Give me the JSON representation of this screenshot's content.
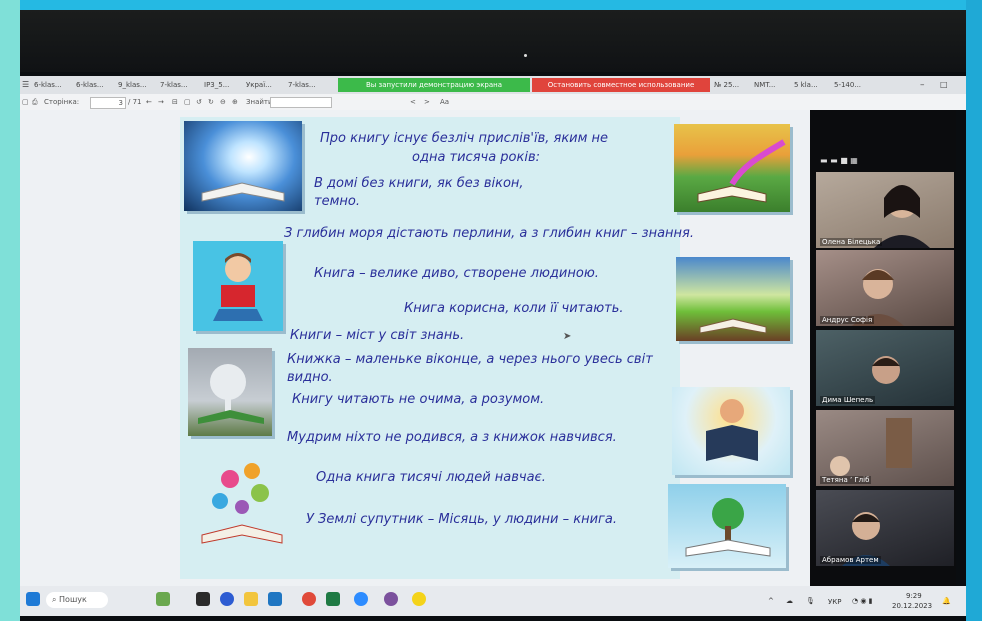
{
  "browser": {
    "tabs": [
      "6-klas...",
      "6-klas...",
      "9_klas...",
      "7-klas...",
      "IP3_5...",
      "Украї...",
      "7-klas...",
      "№ 25...",
      "NMT...",
      "5 kla...",
      "5-140..."
    ],
    "share_banner": "Вы запустили демонстрацию экрана",
    "stop_share": "Остановить совместное использование",
    "address_text": "Аа",
    "nav_back": "<",
    "nav_forward": ">"
  },
  "viewer_toolbar": {
    "page_label": "Сторінка:",
    "page_value": "3",
    "page_total": "/ 71",
    "find_label": "Знайти:"
  },
  "slide": {
    "lines": [
      "Про книгу існує безліч прислів'їв, яким не",
      "одна тисяча років:",
      "В домі без книги, як без вікон,",
      "темно.",
      "З глибин моря дістають перлини, а з глибин книг – знання.",
      "Книга – велике диво, створене людиною.",
      "Книга корисна, коли її читають.",
      "Книги – міст у світ знань.",
      "Книжка – маленьке віконце, а через нього увесь світ",
      "видно.",
      "Книгу читають не очима, а розумом.",
      "Мудрим ніхто не родився, а з книжок навчився.",
      "Одна книга тисячі людей навчає.",
      "У Землі супутник – Місяць, у людини – книга."
    ]
  },
  "participants": [
    {
      "name": "Олена Білецька",
      "color": "#8a7a6c"
    },
    {
      "name": "Андрус Софія",
      "color": "#6d5a52"
    },
    {
      "name": "Дима Шепель",
      "color": "#3a4c52"
    },
    {
      "name": "Тетяна ’ Гліб",
      "color": "#7a6a64"
    },
    {
      "name": "Абрамов Артем",
      "color": "#3b3d44"
    }
  ],
  "taskbar": {
    "search_label": "Пошук",
    "language": "УКР",
    "time": "9:29",
    "date": "20.12.2023"
  },
  "colors": {
    "frame": "#2ec0e6",
    "slide_text": "#2a2f9a",
    "share_green": "#3cba4a",
    "share_red": "#e0443c"
  }
}
